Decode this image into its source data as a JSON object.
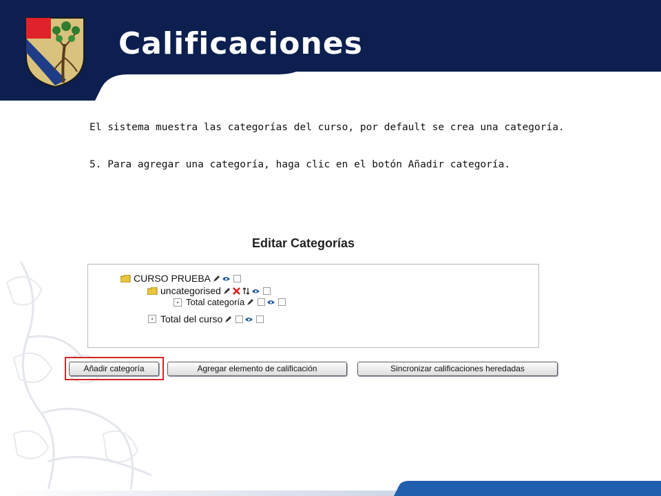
{
  "header": {
    "title": "Calificaciones"
  },
  "colors": {
    "navy": "#0c1f4f",
    "highlight_red": "#d42424",
    "delete_red": "#d81f1f",
    "folder_yellow": "#e8c53c"
  },
  "instructions": {
    "line1": "El sistema muestra las categorías del curso, por default se crea una categoría.",
    "line2": "5. Para agregar una categoría, haga clic en el botón Añadir categoría."
  },
  "screenshot": {
    "heading": "Editar Categorías",
    "tree": [
      {
        "label": "CURSO PRUEBA",
        "icons": [
          "edit-icon",
          "eye-icon",
          "checkbox"
        ]
      },
      {
        "label": "uncategorised",
        "icons": [
          "edit-icon",
          "delete-icon",
          "move-icon",
          "eye-icon",
          "checkbox"
        ]
      },
      {
        "label": "Total categoría",
        "icons": [
          "edit-icon",
          "checkbox",
          "eye-icon",
          "checkbox"
        ]
      },
      {
        "label": "Total del curso",
        "icons": [
          "edit-icon",
          "checkbox",
          "eye-icon",
          "checkbox"
        ]
      }
    ],
    "buttons": {
      "add_category": "Añadir categoría",
      "add_grade_item": "Agregar elemento de calificación",
      "sync_grades": "Sincronizar calificaciones heredadas"
    }
  }
}
